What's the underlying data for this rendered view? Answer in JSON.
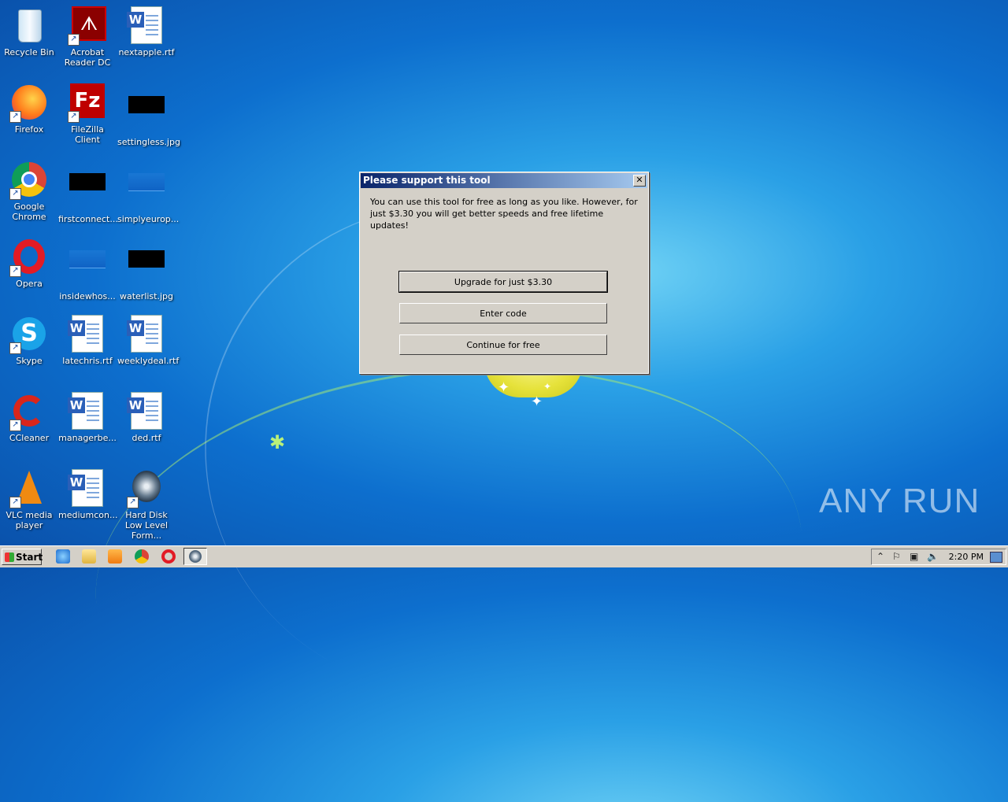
{
  "desktop": {
    "icons": [
      {
        "label": "Recycle Bin"
      },
      {
        "label": "Acrobat Reader DC"
      },
      {
        "label": "nextapple.rtf"
      },
      {
        "label": "Firefox"
      },
      {
        "label": "FileZilla Client"
      },
      {
        "label": "settingless.jpg"
      },
      {
        "label": "Google Chrome"
      },
      {
        "label": "firstconnect..."
      },
      {
        "label": "simplyeurop..."
      },
      {
        "label": "Opera"
      },
      {
        "label": "insidewhos..."
      },
      {
        "label": "waterlist.jpg"
      },
      {
        "label": "Skype"
      },
      {
        "label": "latechris.rtf"
      },
      {
        "label": "weeklydeal.rtf"
      },
      {
        "label": "CCleaner"
      },
      {
        "label": "managerbe..."
      },
      {
        "label": "ded.rtf"
      },
      {
        "label": "VLC media player"
      },
      {
        "label": "mediumcon..."
      },
      {
        "label": "Hard Disk Low Level Form..."
      }
    ],
    "watermark": "ANY RUN"
  },
  "dialog": {
    "title": "Please support this tool",
    "message": "You can use this tool for free as long as you like. However, for just $3.30 you will get better speeds and free lifetime updates!",
    "buttons": {
      "upgrade": "Upgrade for just $3.30",
      "enter_code": "Enter code",
      "continue": "Continue for free"
    }
  },
  "taskbar": {
    "start_label": "Start",
    "clock": "2:20 PM"
  },
  "colors": {
    "dialog_face": "#d4d0c8",
    "titlebar_start": "#0a246a",
    "titlebar_end": "#a6caf0"
  }
}
